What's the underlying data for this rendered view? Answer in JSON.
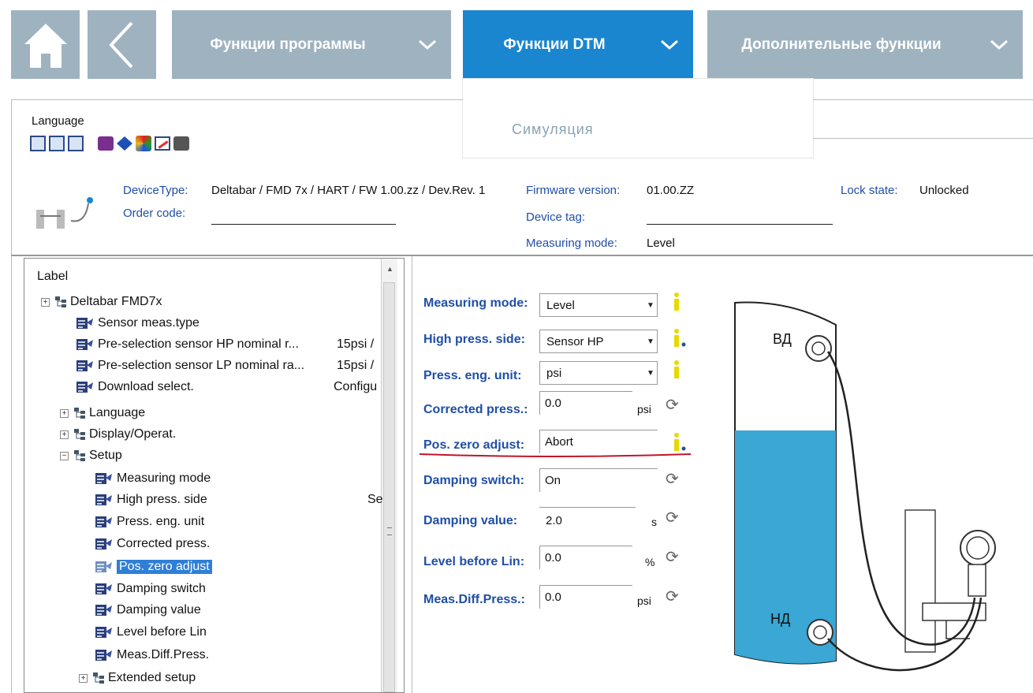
{
  "nav": {
    "home_label": "home",
    "back_label": "back",
    "program_functions": "Функции программы",
    "dtm_functions": "Функции DTM",
    "extra_functions": "Дополнительные функции",
    "dropdown_item": "Симуляция"
  },
  "toolbar": {
    "language_label": "Language"
  },
  "device": {
    "device_type_label": "DeviceType:",
    "device_type_value": "Deltabar / FMD 7x / HART / FW 1.00.zz / Dev.Rev. 1",
    "order_code_label": "Order code:",
    "order_code_value": "",
    "firmware_label": "Firmware version:",
    "firmware_value": "01.00.ZZ",
    "device_tag_label": "Device tag:",
    "device_tag_value": "",
    "measuring_mode_label": "Measuring mode:",
    "measuring_mode_value": "Level",
    "lock_label": "Lock state:",
    "lock_value": "Unlocked"
  },
  "tree": {
    "header": "Label",
    "items": [
      {
        "label": "Deltabar FMD7x",
        "value": ""
      },
      {
        "label": "Sensor meas.type",
        "value": ""
      },
      {
        "label": "Pre-selection sensor HP nominal r...",
        "value": "15psi /"
      },
      {
        "label": "Pre-selection sensor LP nominal ra...",
        "value": "15psi /"
      },
      {
        "label": "Download select.",
        "value": "Configu"
      },
      {
        "label": "Language",
        "value": ""
      },
      {
        "label": "Display/Operat.",
        "value": ""
      },
      {
        "label": "Setup",
        "value": ""
      },
      {
        "label": "Measuring mode",
        "value": ""
      },
      {
        "label": "High press. side",
        "value": "Se"
      },
      {
        "label": "Press. eng. unit",
        "value": ""
      },
      {
        "label": "Corrected press.",
        "value": ""
      },
      {
        "label": "Pos. zero adjust",
        "value": ""
      },
      {
        "label": "Damping switch",
        "value": ""
      },
      {
        "label": "Damping value",
        "value": ""
      },
      {
        "label": "Level before Lin",
        "value": ""
      },
      {
        "label": "Meas.Diff.Press.",
        "value": ""
      },
      {
        "label": "Extended setup",
        "value": ""
      }
    ]
  },
  "form": {
    "measuring_mode": {
      "label": "Measuring mode:",
      "value": "Level"
    },
    "high_press_side": {
      "label": "High press. side:",
      "value": "Sensor HP"
    },
    "press_eng_unit": {
      "label": "Press. eng. unit:",
      "value": "psi"
    },
    "corrected_press": {
      "label": "Corrected press.:",
      "value": "0.0",
      "unit": "psi"
    },
    "pos_zero_adjust": {
      "label": "Pos. zero adjust:",
      "value": "Abort"
    },
    "damping_switch": {
      "label": "Damping switch:",
      "value": "On"
    },
    "damping_value": {
      "label": "Damping value:",
      "value": "2.0",
      "unit": "s"
    },
    "level_before_lin": {
      "label": "Level before Lin:",
      "value": "0.0",
      "unit": "%"
    },
    "meas_diff_press": {
      "label": "Meas.Diff.Press.:",
      "value": "0.0",
      "unit": "psi"
    }
  },
  "diagram": {
    "hp_label": "ВД",
    "lp_label": "НД"
  },
  "colors": {
    "nav_gray": "#9fb2c0",
    "nav_active": "#1a86d0",
    "link_blue": "#1f4fa6",
    "highlight_red": "#c0152a",
    "liquid": "#3aa7d4"
  }
}
